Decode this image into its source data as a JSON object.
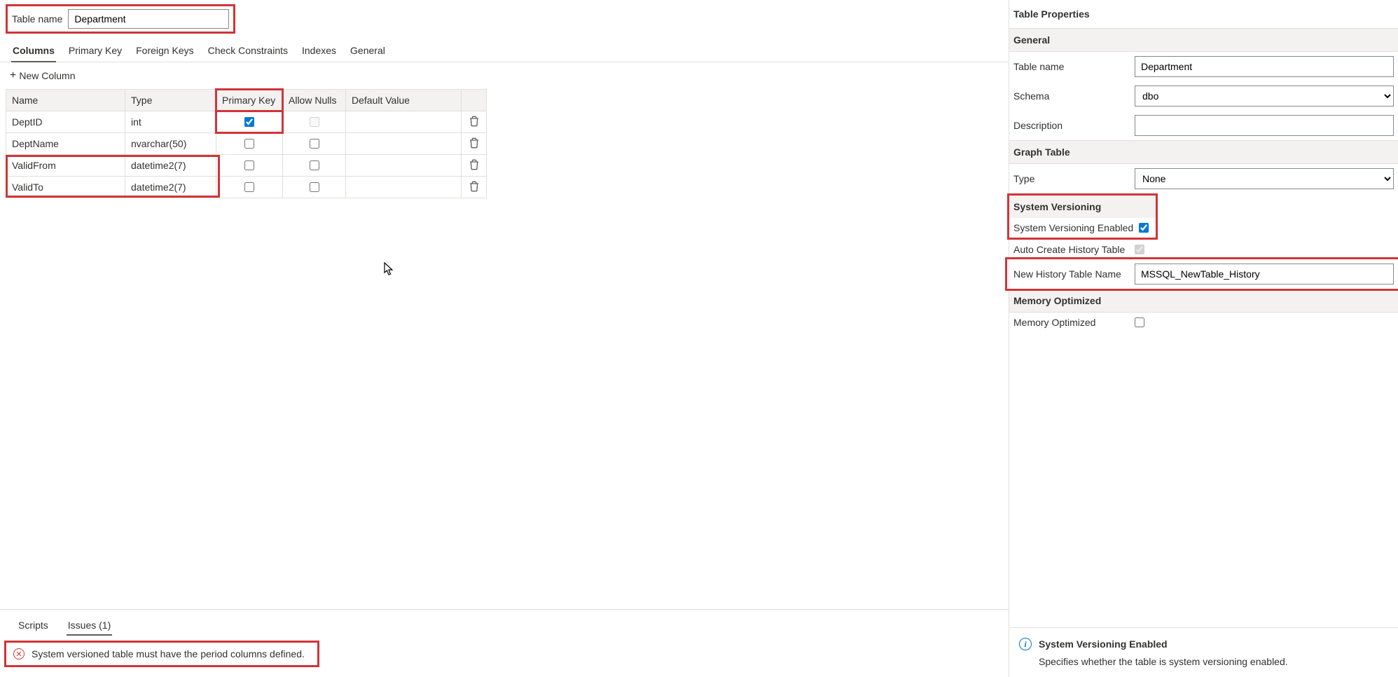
{
  "top": {
    "label": "Table name",
    "value": "Department"
  },
  "main_tabs": {
    "columns": "Columns",
    "primary_key": "Primary Key",
    "foreign_keys": "Foreign Keys",
    "check_constraints": "Check Constraints",
    "indexes": "Indexes",
    "general": "General"
  },
  "newcol": "New Column",
  "headers": {
    "name": "Name",
    "type": "Type",
    "pk": "Primary Key",
    "nulls": "Allow Nulls",
    "default": "Default Value"
  },
  "rows": [
    {
      "name": "DeptID",
      "type": "int",
      "pk": true,
      "nulls": false,
      "nulls_disabled": true,
      "default": ""
    },
    {
      "name": "DeptName",
      "type": "nvarchar(50)",
      "pk": false,
      "nulls": false,
      "nulls_disabled": false,
      "default": ""
    },
    {
      "name": "ValidFrom",
      "type": "datetime2(7)",
      "pk": false,
      "nulls": false,
      "nulls_disabled": false,
      "default": ""
    },
    {
      "name": "ValidTo",
      "type": "datetime2(7)",
      "pk": false,
      "nulls": false,
      "nulls_disabled": false,
      "default": ""
    }
  ],
  "bottom_tabs": {
    "scripts": "Scripts",
    "issues": "Issues (1)"
  },
  "issue": "System versioned table must have the period columns defined.",
  "props": {
    "title": "Table Properties",
    "general_head": "General",
    "table_name_label": "Table name",
    "table_name_value": "Department",
    "schema_label": "Schema",
    "schema_value": "dbo",
    "description_label": "Description",
    "description_value": "",
    "graph_head": "Graph Table",
    "type_label": "Type",
    "type_value": "None",
    "sv_head": "System Versioning",
    "sv_enabled_label": "System Versioning Enabled",
    "sv_enabled": true,
    "auto_create_label": "Auto Create History Table",
    "auto_create": true,
    "history_name_label": "New History Table Name",
    "history_name_value": "MSSQL_NewTable_History",
    "mo_head": "Memory Optimized",
    "mo_label": "Memory Optimized",
    "mo_value": false
  },
  "info": {
    "title": "System Versioning Enabled",
    "body": "Specifies whether the table is system versioning enabled."
  }
}
